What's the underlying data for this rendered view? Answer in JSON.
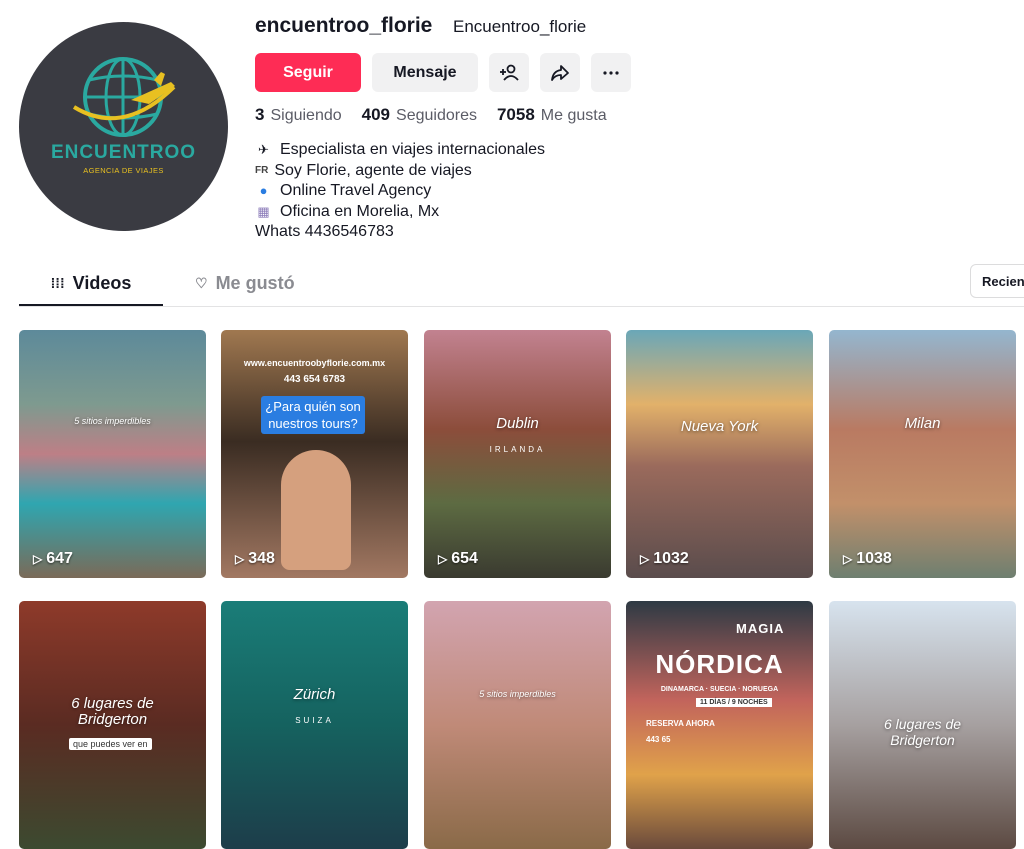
{
  "profile": {
    "username": "encuentroo_florie",
    "nickname": "Encuentroo_florie",
    "avatar": {
      "brand": "ENCUENTROO",
      "subtitle": "AGENCIA DE VIAJES"
    },
    "follow_label": "Seguir",
    "message_label": "Mensaje",
    "stats": {
      "following": {
        "count": "3",
        "label": "Siguiendo"
      },
      "followers": {
        "count": "409",
        "label": "Seguidores"
      },
      "likes": {
        "count": "7058",
        "label": "Me gusta"
      }
    },
    "bio": [
      {
        "icon": "✈️",
        "text": "Especialista en viajes internacionales"
      },
      {
        "icon": "FR",
        "text": "Soy Florie, agente de viajes"
      },
      {
        "icon": "🌎",
        "text": "Online Travel Agency"
      },
      {
        "icon": "🏢",
        "text": "Oficina en Morelia, Mx"
      },
      {
        "icon": "",
        "text": "Whats 4436546783"
      }
    ]
  },
  "tabs": [
    {
      "label": "Videos",
      "icon": "grid-icon",
      "active": true
    },
    {
      "label": "Me gustó",
      "icon": "heart-icon",
      "active": false
    }
  ],
  "sort_label": "Recien",
  "videos": [
    {
      "overlay": "5 sitios imperdibles",
      "views": "647"
    },
    {
      "website": "www.encuentroobyflorie.com.mx",
      "phone": "443 654 6783",
      "overlay": "¿Para quién son nuestros tours?",
      "views": "348"
    },
    {
      "overlay": "Dublin",
      "country": "IRLANDA",
      "views": "654"
    },
    {
      "overlay": "Nueva York",
      "views": "1032"
    },
    {
      "overlay": "Milan",
      "views": "1038"
    },
    {
      "overlay": "6 lugares de Bridgerton",
      "sub": "que puedes ver en"
    },
    {
      "overlay": "Zürich",
      "country": "SUIZA"
    },
    {
      "overlay": "5 sitios imperdibles"
    },
    {
      "magia": "MAGIA",
      "title": "NÓRDICA",
      "sub": "DINAMARCA · SUECIA · NORUEGA",
      "days": "11 DÍAS / 9 NOCHES",
      "reserva": "RESERVA AHORA",
      "tel": "443 65"
    },
    {
      "overlay": "6 lugares de Bridgerton"
    }
  ],
  "colors": {
    "primary": "#fe2c55",
    "text": "#161823",
    "muted": "#8a8b91",
    "avatar_bg": "#3a3b42",
    "brand_teal": "#2aa9a0",
    "brand_yellow": "#e8c021"
  }
}
